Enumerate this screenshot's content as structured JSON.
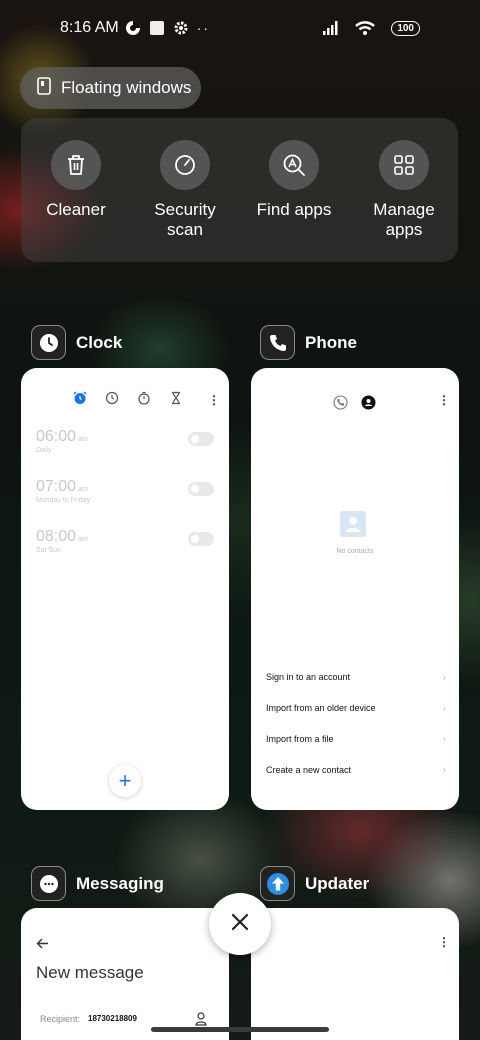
{
  "status_bar": {
    "time": "8:16 AM",
    "battery": "100"
  },
  "floating_windows": {
    "label": "Floating windows"
  },
  "quick_actions": [
    {
      "label": "Cleaner",
      "icon": "trash-icon"
    },
    {
      "label": "Security scan",
      "icon": "shield-gauge-icon"
    },
    {
      "label": "Find apps",
      "icon": "search-a-icon"
    },
    {
      "label": "Manage apps",
      "icon": "grid-icon"
    }
  ],
  "apps": {
    "clock": {
      "title": "Clock",
      "alarms": [
        {
          "time": "06:00",
          "ampm": "am",
          "repeat": "Daily"
        },
        {
          "time": "07:00",
          "ampm": "am",
          "repeat": "Monday to Friday"
        },
        {
          "time": "08:00",
          "ampm": "am",
          "repeat": "Sat Sun"
        }
      ],
      "fab": "+"
    },
    "phone": {
      "title": "Phone",
      "empty_state": "No contacts",
      "menu": [
        "Sign in to an account",
        "Import from an older device",
        "Import from a file",
        "Create a new contact"
      ]
    },
    "messaging": {
      "title": "Messaging",
      "heading": "New message",
      "recipient_label": "Recipient:",
      "recipient_value": "18730218809"
    },
    "updater": {
      "title": "Updater"
    }
  },
  "colors": {
    "accent_blue": "#1a73e8",
    "card_bg": "#ffffff",
    "updater_blue": "#2a8fe0"
  }
}
